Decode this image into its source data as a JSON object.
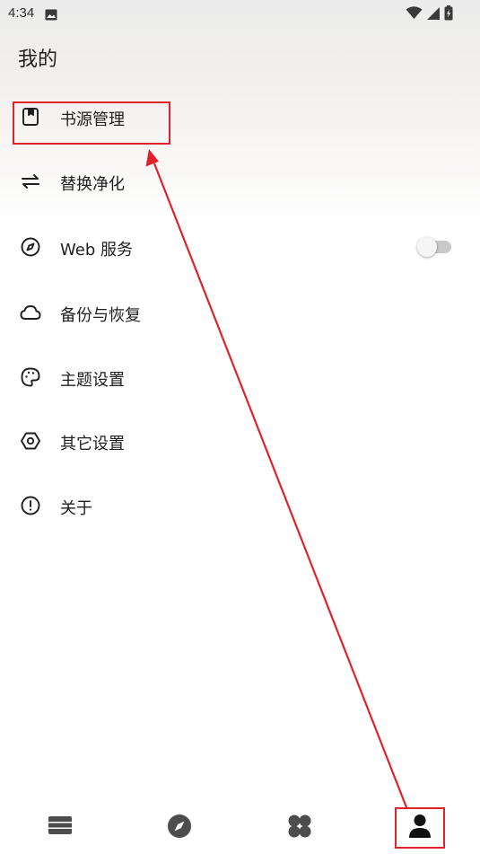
{
  "status_bar": {
    "time": "4:34",
    "left_icons": [
      "image-icon"
    ],
    "right_icons": [
      "wifi-icon",
      "signal-icon",
      "battery-icon"
    ]
  },
  "page": {
    "title": "我的"
  },
  "menu": {
    "items": [
      {
        "label": "书源管理",
        "icon": "book-source-icon"
      },
      {
        "label": "替换净化",
        "icon": "swap-icon"
      },
      {
        "label": "Web 服务",
        "icon": "compass-icon",
        "toggle": false
      },
      {
        "label": "备份与恢复",
        "icon": "cloud-icon"
      },
      {
        "label": "主题设置",
        "icon": "palette-icon"
      },
      {
        "label": "其它设置",
        "icon": "settings-icon"
      },
      {
        "label": "关于",
        "icon": "info-icon"
      }
    ]
  },
  "bottom_nav": {
    "items": [
      {
        "icon": "bookshelf-icon"
      },
      {
        "icon": "explore-icon"
      },
      {
        "icon": "rss-icon"
      },
      {
        "icon": "profile-icon",
        "selected": true
      }
    ]
  },
  "annotation": {
    "color": "#e0222a"
  }
}
